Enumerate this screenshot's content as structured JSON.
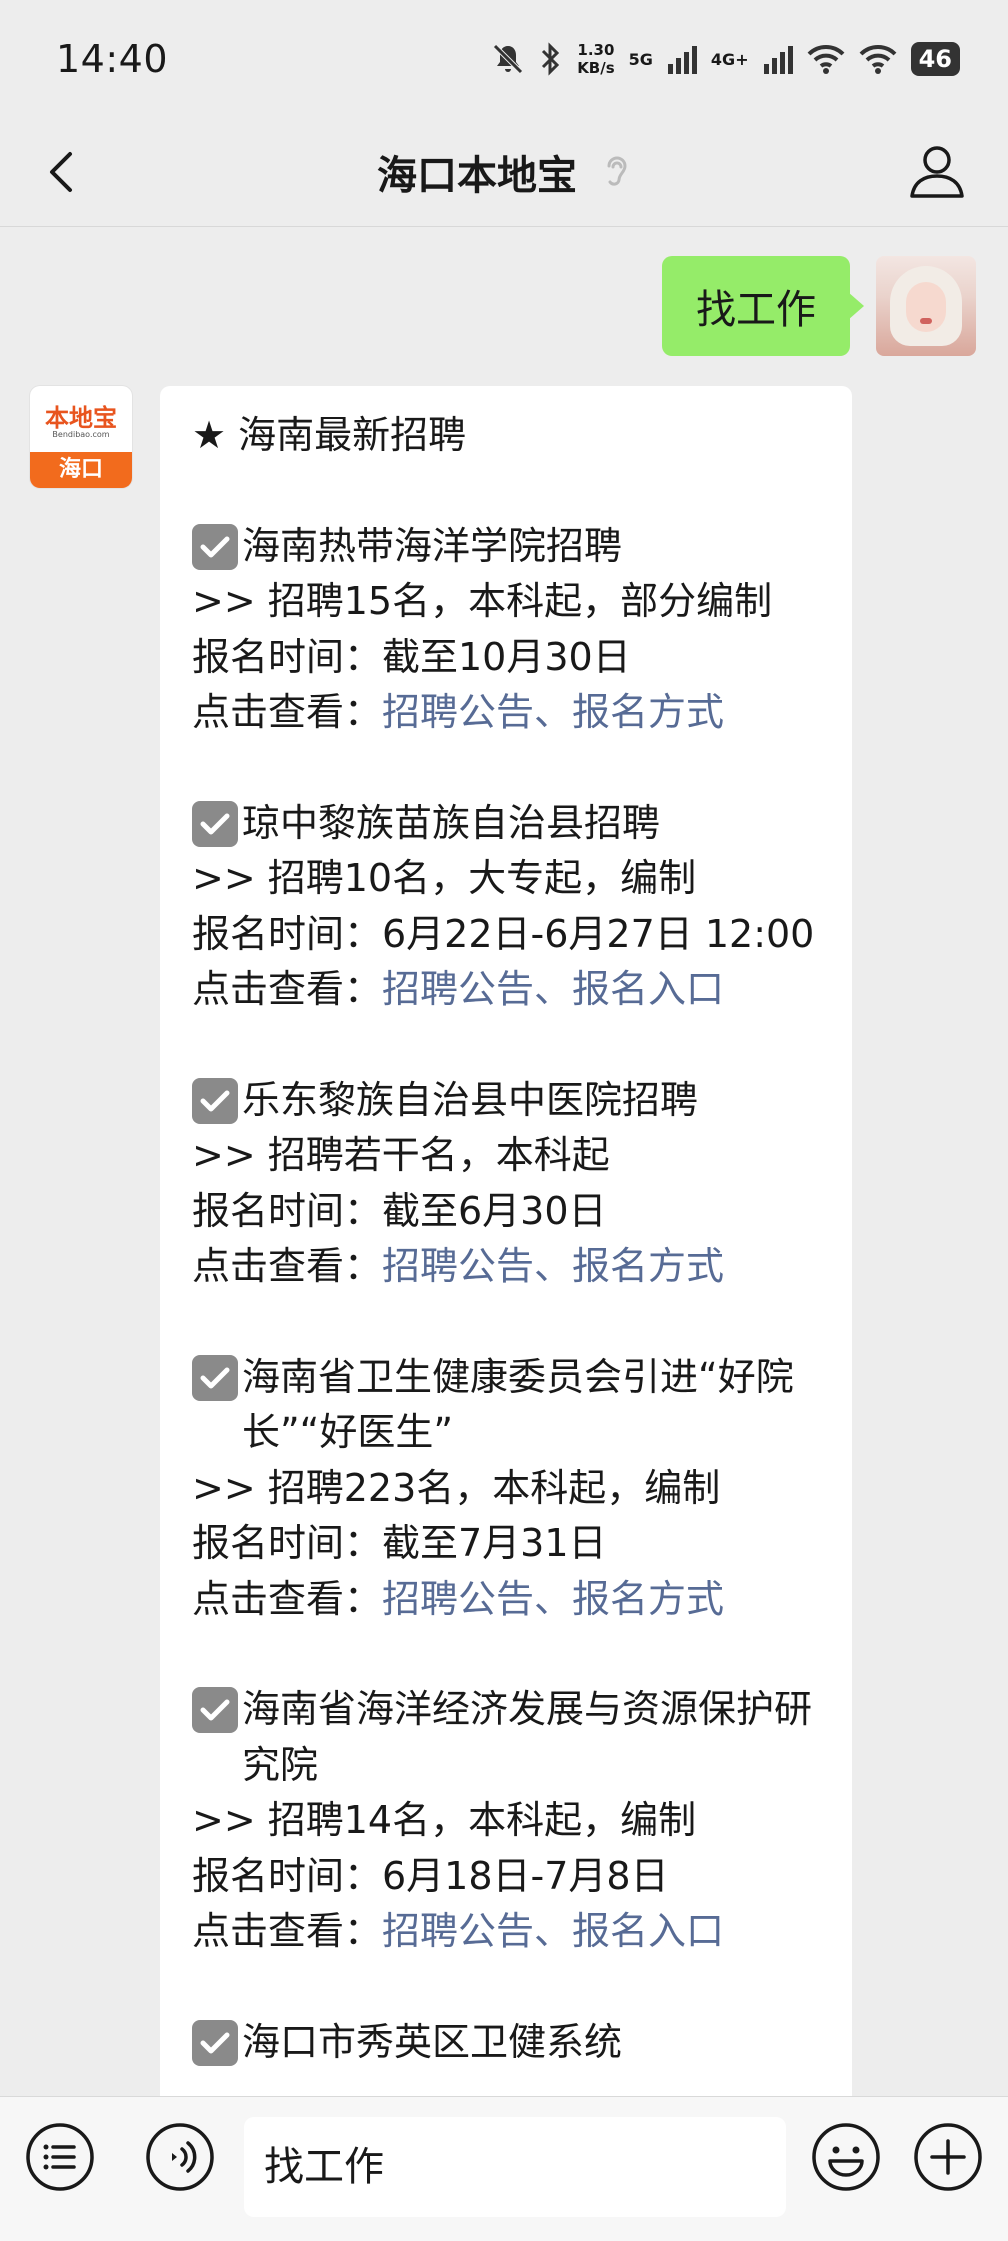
{
  "status_bar": {
    "time": "14:40",
    "net_speed_value": "1.30",
    "net_speed_unit": "KB/s",
    "signal1_label": "5G",
    "signal2_label": "4G+",
    "battery": "46"
  },
  "nav": {
    "title": "海口本地宝"
  },
  "user_message": "找工作",
  "bot_logo": {
    "top": "本地宝",
    "sub": "Bendibao.com",
    "band": "海口"
  },
  "bot_message": {
    "header": "★ 海南最新招聘",
    "jobs": [
      {
        "title": "海南热带海洋学院招聘",
        "detail": ">> 招聘15名，本科起，部分编制",
        "time": "报名时间：截至10月30日",
        "see_label": "点击查看：",
        "links": "招聘公告、报名方式"
      },
      {
        "title": "琼中黎族苗族自治县招聘",
        "detail": ">> 招聘10名，大专起，编制",
        "time": "报名时间：6月22日-6月27日 12:00",
        "see_label": "点击查看：",
        "links": "招聘公告、报名入口"
      },
      {
        "title": "乐东黎族自治县中医院招聘",
        "detail": ">> 招聘若干名，本科起",
        "time": "报名时间：截至6月30日",
        "see_label": "点击查看：",
        "links": "招聘公告、报名方式"
      },
      {
        "title": "海南省卫生健康委员会引进“好院长”“好医生”",
        "detail": ">> 招聘223名，本科起，编制",
        "time": "报名时间：截至7月31日",
        "see_label": "点击查看：",
        "links": "招聘公告、报名方式"
      },
      {
        "title": "海南省海洋经济发展与资源保护研究院",
        "detail": ">> 招聘14名，本科起，编制",
        "time": "报名时间：6月18日-7月8日",
        "see_label": "点击查看：",
        "links": "招聘公告、报名入口"
      },
      {
        "title": "海口市秀英区卫健系统",
        "detail": "",
        "time": "",
        "see_label": "",
        "links": ""
      }
    ]
  },
  "input_bar": {
    "text": "找工作"
  },
  "icons": {
    "nav_back": "chevron-left-icon",
    "nav_ear": "ear-icon",
    "nav_profile": "person-icon",
    "menu": "list-icon",
    "voice": "voice-icon",
    "emoji": "emoji-icon",
    "plus": "plus-icon"
  }
}
